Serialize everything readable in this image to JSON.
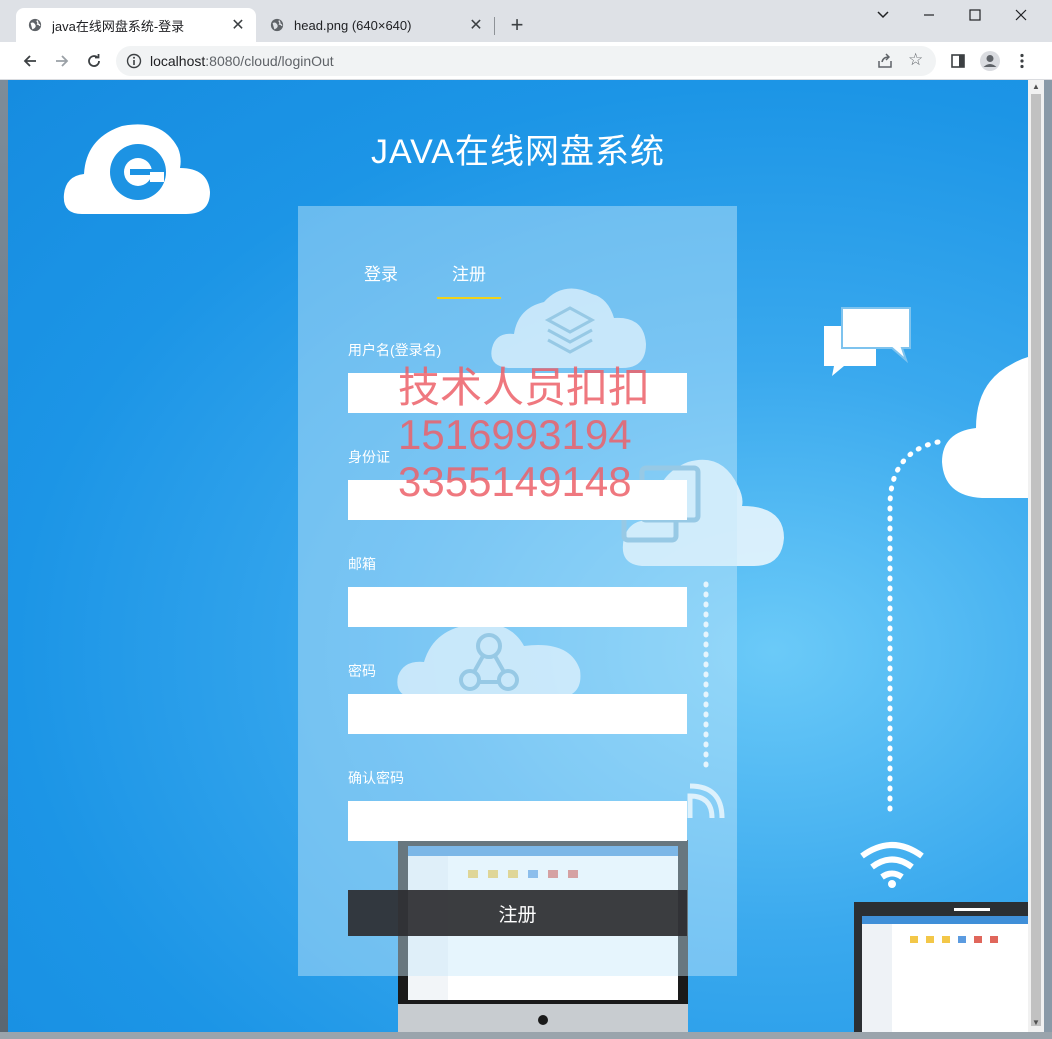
{
  "browser": {
    "tabs": [
      {
        "title": "java在线网盘系统-登录",
        "active": true
      },
      {
        "title": "head.png (640×640)",
        "active": false
      }
    ],
    "url_host": "localhost",
    "url_rest": ":8080/cloud/loginOut"
  },
  "page": {
    "title": "JAVA在线网盘系统",
    "tabs": {
      "login": "登录",
      "register": "注册"
    },
    "fields": [
      {
        "label": "用户名(登录名)",
        "value": ""
      },
      {
        "label": "身份证",
        "value": ""
      },
      {
        "label": "邮箱",
        "value": ""
      },
      {
        "label": "密码",
        "value": ""
      },
      {
        "label": "确认密码",
        "value": ""
      }
    ],
    "submit_label": "注册",
    "watermark": [
      "技术人员扣扣",
      "1516993194",
      "3355149148"
    ]
  },
  "colors": {
    "accent_underline": "#f0d21a",
    "background_blue": "#1c95e6",
    "button_dark": "#2d2d30"
  }
}
